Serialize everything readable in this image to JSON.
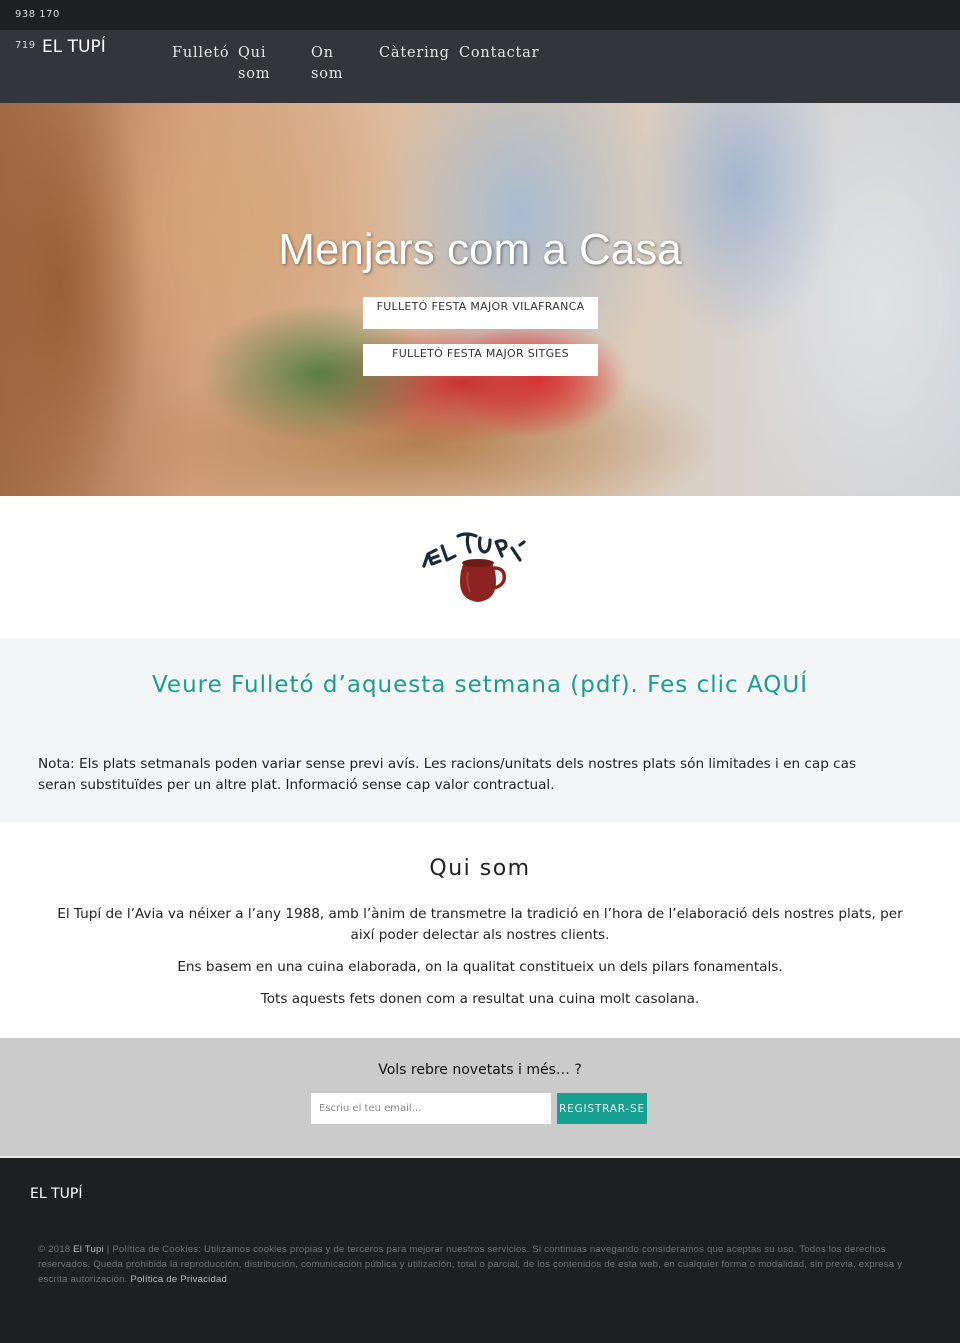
{
  "topbar": {
    "phone_part1": "938 170"
  },
  "header": {
    "phone_part2": "719",
    "brand": "EL TUPÍ",
    "nav": [
      {
        "label": "Fulletó"
      },
      {
        "label": "Qui som"
      },
      {
        "label": "On som"
      },
      {
        "label": "Càtering"
      },
      {
        "label": "Contactar"
      }
    ]
  },
  "hero": {
    "title": "Menjars com a Casa",
    "buttons": [
      {
        "label": "FULLETÓ FESTA MAJOR VILAFRANCA"
      },
      {
        "label": "FULLETÓ FESTA MAJOR SITGES"
      }
    ]
  },
  "logo": {
    "alt": "El Tupí logo",
    "text": "EL TUPÍ",
    "jug_color": "#8c2320"
  },
  "pdf_section": {
    "link": "Veure Fulletó d’aquesta setmana (pdf). Fes clic AQUÍ",
    "note": "Nota: Els plats setmanals poden variar sense previ avís. Les racions/unitats dels nostres plats són limitades i en cap cas seran substituïdes per un altre plat. Informació sense cap valor contractual."
  },
  "about": {
    "title": "Qui som",
    "paragraphs": [
      "El Tupí de l’Avia va néixer a l’any 1988, amb l’ànim de transmetre la tradició en l’hora de l’elaboració dels nostres plats, per així poder delectar als nostres clients.",
      "Ens basem en una cuina elaborada, on la qualitat constitueix un dels pilars fonamentals.",
      "Tots aquests fets donen com a resultat una cuina molt casolana."
    ]
  },
  "newsletter": {
    "title": "Vols rebre novetats i més… ?",
    "email_placeholder": "Escriu el teu email...",
    "email_value": "",
    "register_label": "REGISTRAR-SE"
  },
  "footer": {
    "brand": "EL TUPÍ",
    "copyright_prefix": "© 2018 ",
    "copyright_link": "El Tupi",
    "legal_text": " | Política de Cookies: Utilizamos cookies propias y de terceros para mejorar nuestros servicios. Si continuas navegando consideramos que aceptas su uso. Todos los derechos reservados. Queda prohibida la reproducción, distribución, comunicación pública y utilización, total o parcial, de los contenidos de esta web, en cualquier forma o modalidad, sin previa, expresa y escrita autorización. ",
    "privacy_link": "Política de Privacidad"
  },
  "colors": {
    "accent": "#16a091",
    "link_teal": "#1a9e8c",
    "topbar_bg": "#1d1f23",
    "header_bg": "#32353a",
    "newsletter_bg": "#cbcbcb",
    "pdf_section_bg": "#f4f5f7"
  }
}
